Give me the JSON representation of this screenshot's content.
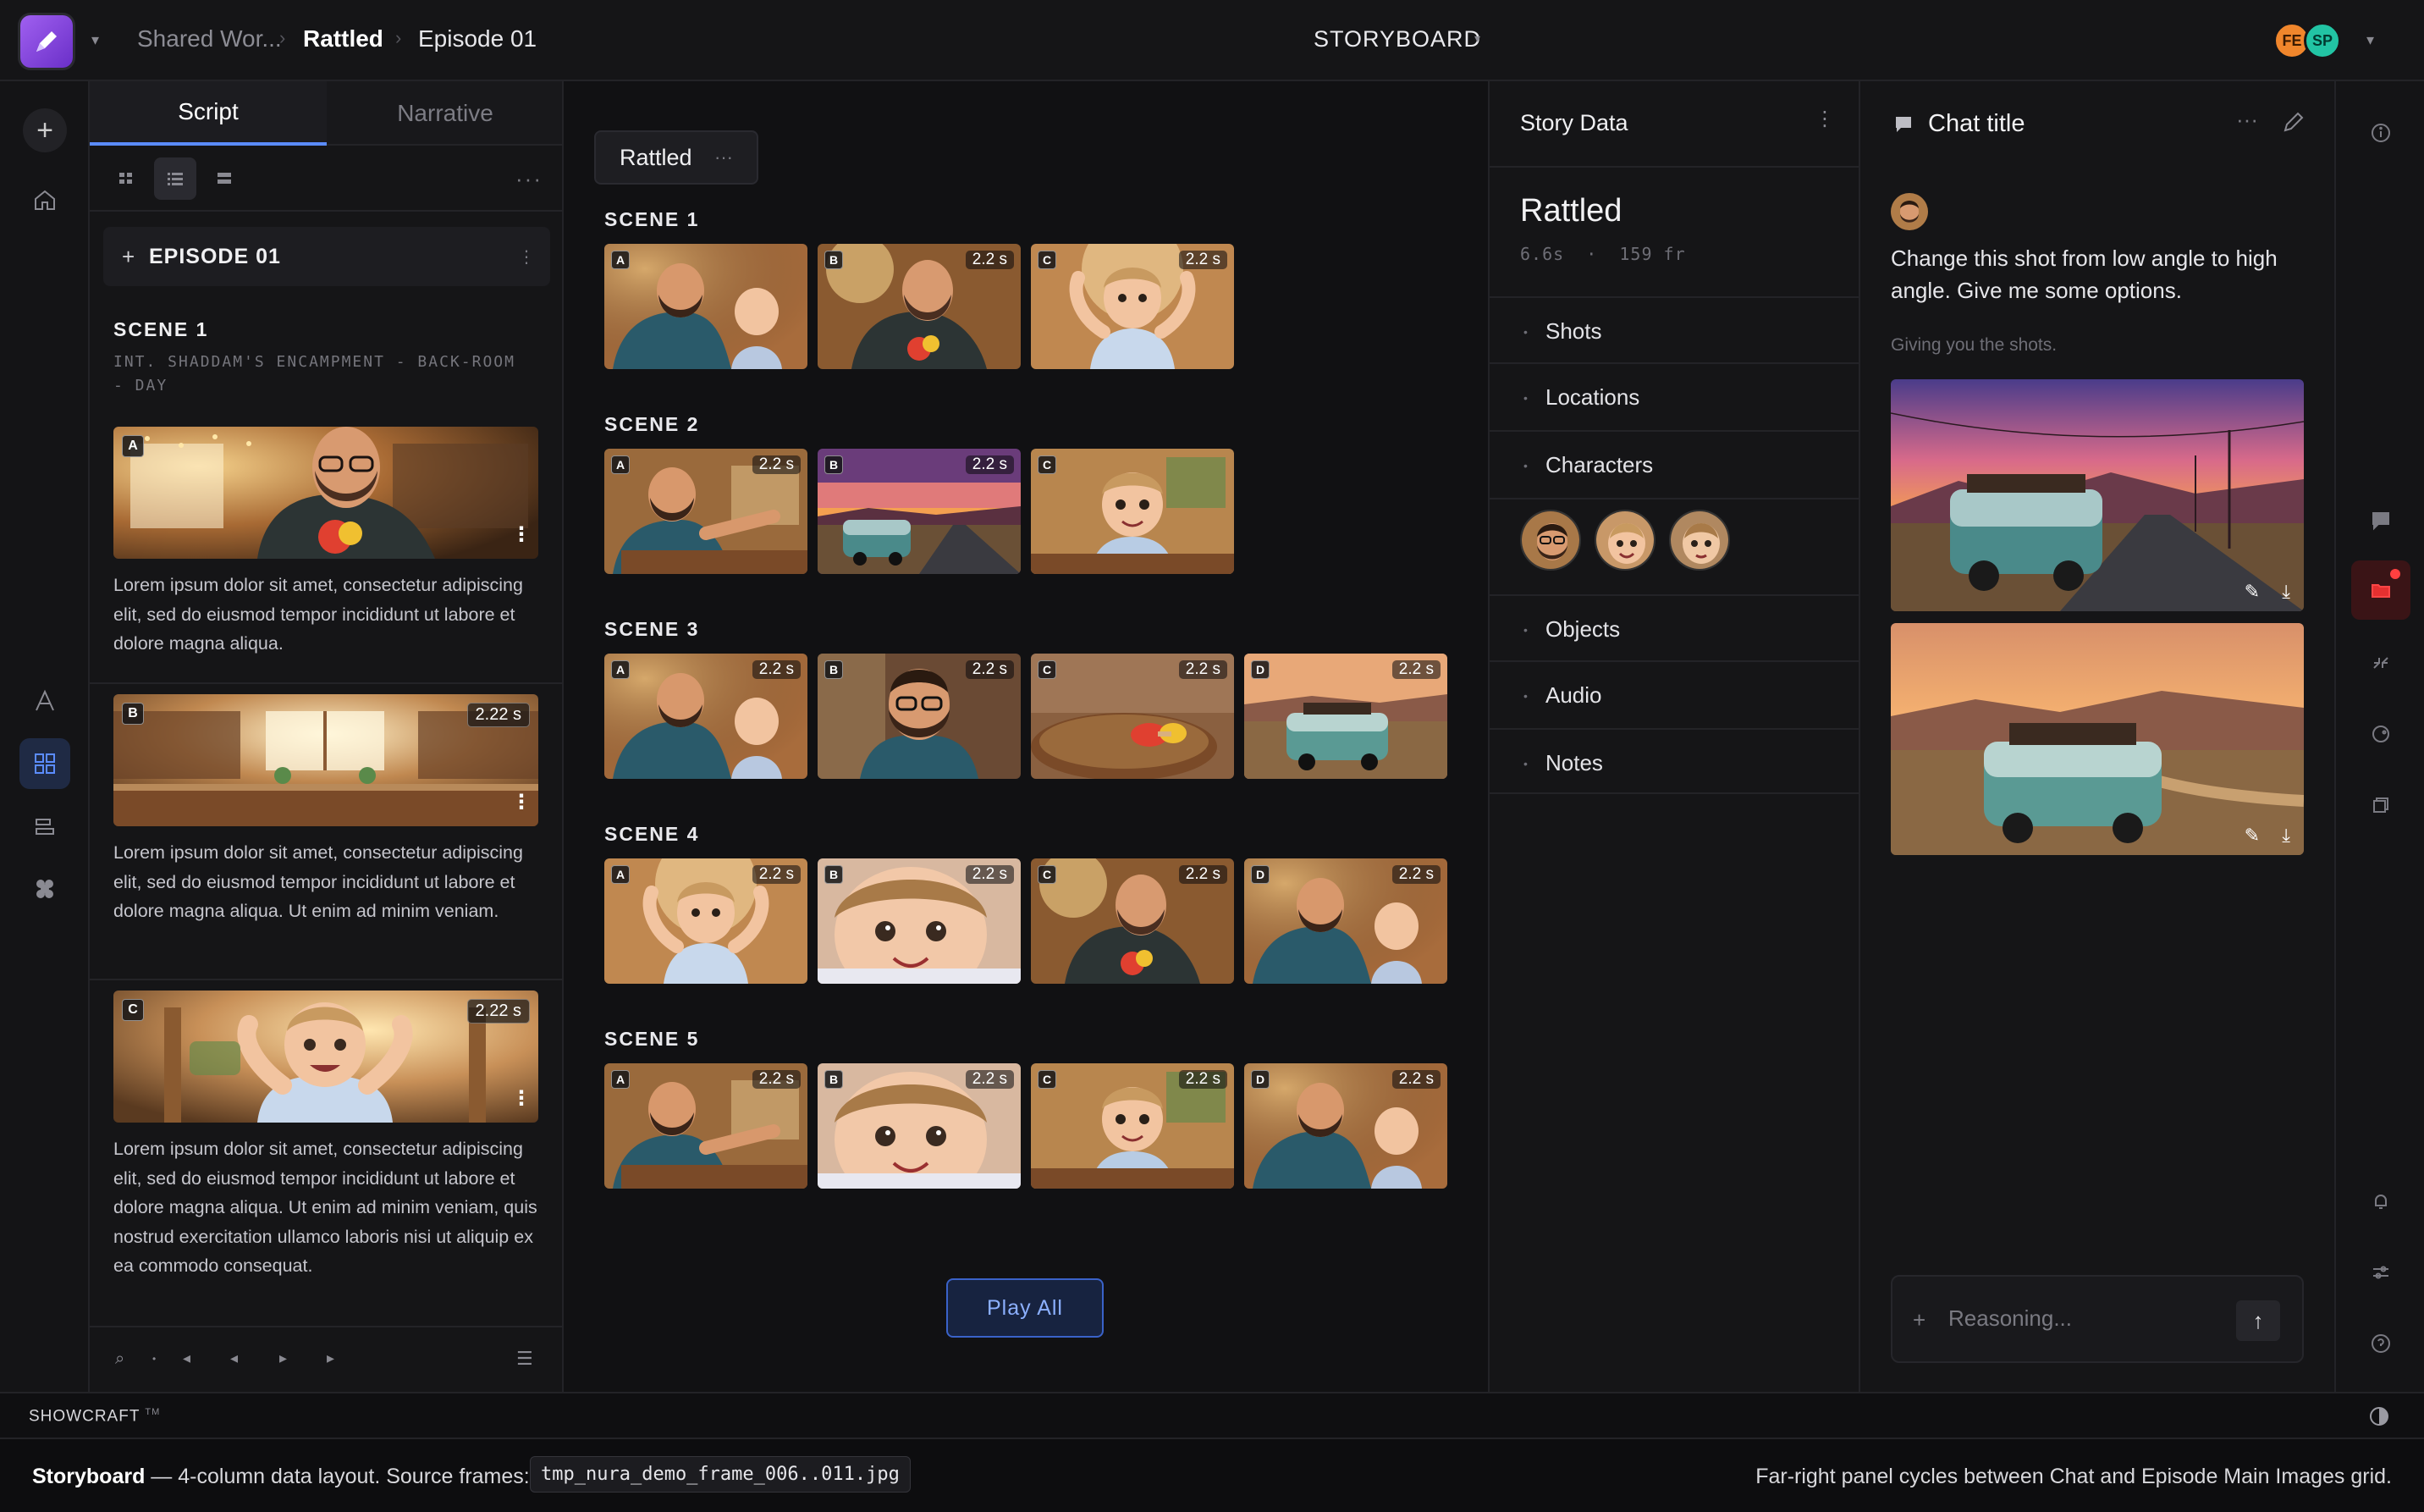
{
  "header": {
    "breadcrumb": [
      "Shared Wor...",
      "Rattled",
      "Episode 01"
    ],
    "app_title": "STORYBOARD",
    "avatars": [
      {
        "initials": "FE",
        "color": "#f0862c"
      },
      {
        "initials": "SP",
        "color": "#22c4a4"
      }
    ]
  },
  "script_panel": {
    "tabs": [
      "Script",
      "Narrative"
    ],
    "episode_label": "EPISODE 01",
    "scene_title": "SCENE 1",
    "scene_location": "INT. SHADDAM'S ENCAMPMENT - BACK-ROOM - DAY",
    "shots": [
      {
        "letter": "A",
        "duration": "",
        "text": "Lorem ipsum dolor sit amet, consectetur adipiscing elit, sed do eiusmod tempor incididunt ut labore et dolore magna aliqua."
      },
      {
        "letter": "B",
        "duration": "2.22 s",
        "text": "Lorem ipsum dolor sit amet, consectetur adipiscing elit, sed do eiusmod tempor incididunt ut labore et dolore magna aliqua. Ut enim ad minim veniam."
      },
      {
        "letter": "C",
        "duration": "2.22 s",
        "text": "Lorem ipsum dolor sit amet, consectetur adipiscing elit, sed do eiusmod tempor incididunt ut labore et dolore magna aliqua. Ut enim ad minim veniam, quis nostrud exercitation ullamco laboris nisi ut aliquip ex ea commodo consequat."
      }
    ]
  },
  "board": {
    "project_chip": "Rattled",
    "scenes": [
      {
        "title": "SCENE 1",
        "shots": [
          {
            "letter": "A",
            "duration": "",
            "art": "dad-baby"
          },
          {
            "letter": "B",
            "duration": "2.2 s",
            "art": "dad-toy"
          },
          {
            "letter": "C",
            "duration": "2.2 s",
            "art": "baby-arms"
          }
        ]
      },
      {
        "title": "SCENE 2",
        "shots": [
          {
            "letter": "A",
            "duration": "2.2 s",
            "art": "dad-reach"
          },
          {
            "letter": "B",
            "duration": "2.2 s",
            "art": "van-sunset"
          },
          {
            "letter": "C",
            "duration": "",
            "art": "baby-chair"
          }
        ]
      },
      {
        "title": "SCENE 3",
        "shots": [
          {
            "letter": "A",
            "duration": "2.2 s",
            "art": "dad-baby"
          },
          {
            "letter": "B",
            "duration": "2.2 s",
            "art": "dad-portrait"
          },
          {
            "letter": "C",
            "duration": "2.2 s",
            "art": "rattle-table"
          },
          {
            "letter": "D",
            "duration": "2.2 s",
            "art": "van-desert"
          }
        ]
      },
      {
        "title": "SCENE 4",
        "shots": [
          {
            "letter": "A",
            "duration": "2.2 s",
            "art": "baby-arms"
          },
          {
            "letter": "B",
            "duration": "2.2 s",
            "art": "baby-close"
          },
          {
            "letter": "C",
            "duration": "2.2 s",
            "art": "dad-toy"
          },
          {
            "letter": "D",
            "duration": "2.2 s",
            "art": "dad-baby"
          }
        ]
      },
      {
        "title": "SCENE 5",
        "shots": [
          {
            "letter": "A",
            "duration": "2.2 s",
            "art": "dad-reach"
          },
          {
            "letter": "B",
            "duration": "2.2 s",
            "art": "baby-close"
          },
          {
            "letter": "C",
            "duration": "2.2 s",
            "art": "baby-chair"
          },
          {
            "letter": "D",
            "duration": "2.2 s",
            "art": "dad-baby"
          }
        ]
      }
    ],
    "play_all": "Play All"
  },
  "story_data": {
    "title": "Story Data",
    "project_name": "Rattled",
    "duration": "6.6s",
    "frames": "159 fr",
    "sections": [
      "Shots",
      "Locations",
      "Characters",
      "Objects",
      "Audio",
      "Notes"
    ]
  },
  "chat": {
    "title": "Chat title",
    "user_message": "Change this shot from low angle to high angle. Give me some options.",
    "assistant_status": "Giving you the shots.",
    "input_placeholder": "Reasoning..."
  },
  "statusbar": {
    "brand": "SHOWCRAFT",
    "tm": "TM"
  },
  "footer": {
    "label": "Storyboard",
    "description": " — 4-column data layout. Source frames:",
    "code": "tmp_nura_demo_frame_006..011.jpg",
    "right_note": "Far-right panel cycles between Chat and Episode Main Images grid."
  },
  "colors": {
    "accent": "#5b8cff",
    "alert": "#e53030",
    "play_border": "#3a62c8"
  }
}
